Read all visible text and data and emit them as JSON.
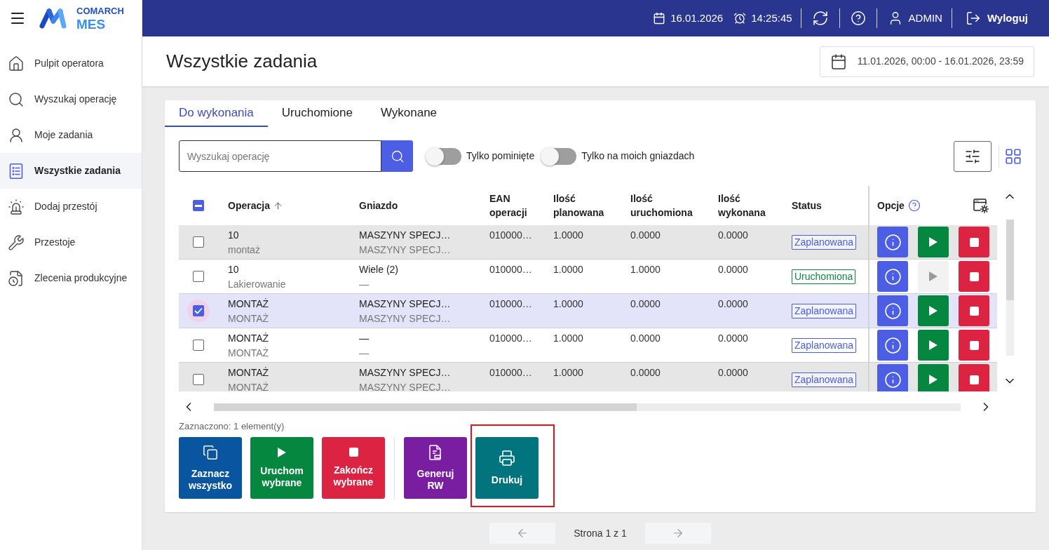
{
  "sidebar": {
    "logo": {
      "brand": "COMARCH",
      "product": "MES"
    },
    "items": [
      {
        "label": "Pulpit operatora",
        "kind": "home",
        "selected": false
      },
      {
        "label": "Wyszukaj operację",
        "kind": "search",
        "selected": false
      },
      {
        "label": "Moje zadania",
        "kind": "person",
        "selected": false
      },
      {
        "label": "Wszystkie zadania",
        "kind": "list",
        "selected": true
      },
      {
        "label": "Dodaj przestój",
        "kind": "siren",
        "selected": false
      },
      {
        "label": "Przestoje",
        "kind": "wrench",
        "selected": false
      },
      {
        "label": "Zlecenia produkcyjne",
        "kind": "orders",
        "selected": false
      }
    ]
  },
  "top_bar": {
    "date": "16.01.2026",
    "time": "14:25:45",
    "user": "ADMIN",
    "logout": "Wyloguj"
  },
  "header": {
    "title": "Wszystkie zadania",
    "date_range": "11.01.2026, 00:00 - 16.01.2026, 23:59"
  },
  "tabs": [
    {
      "label": "Do wykonania",
      "selected": true
    },
    {
      "label": "Uruchomione",
      "selected": false
    },
    {
      "label": "Wykonane",
      "selected": false
    }
  ],
  "search": {
    "placeholder": "Wyszukaj operację"
  },
  "toggles": [
    {
      "label": "Tylko pominięte",
      "on": false
    },
    {
      "label": "Tylko na moich gniazdach",
      "on": false
    }
  ],
  "table": {
    "select_all": {
      "indeterminate": true
    },
    "columns": [
      {
        "label": "Operacja",
        "sorted_ascending": true
      },
      {
        "label": "Gniazdo",
        "sorted_ascending": false
      },
      {
        "label": "EAN operacji",
        "sorted_ascending": false
      },
      {
        "label": "Ilość planowana",
        "sorted_ascending": false
      },
      {
        "label": "Ilość uruchomiona",
        "sorted_ascending": false
      },
      {
        "label": "Ilość wykonana",
        "sorted_ascending": false
      },
      {
        "label": "Status",
        "sorted_ascending": false
      }
    ],
    "options_label": "Opcje",
    "rows": [
      {
        "operation": "10",
        "operation_name": "montaż",
        "workstation": "MASZYNY SPECJ…",
        "workstation_sub": "MASZYNY SPECJ…",
        "ean": "010000…",
        "qty_planned": "1.0000",
        "qty_started": "0.0000",
        "qty_done": "0.0000",
        "status": {
          "label": "Zaplanowana",
          "color": "#4b5ee4"
        },
        "play_disabled": false,
        "selected": false
      },
      {
        "operation": "10",
        "operation_name": "Lakierowanie",
        "workstation": "Wiele (2)",
        "workstation_sub": "—",
        "ean": "010000…",
        "qty_planned": "1.0000",
        "qty_started": "1.0000",
        "qty_done": "0.0000",
        "status": {
          "label": "Uruchomiona",
          "color": "#0a8a3f"
        },
        "play_disabled": true,
        "selected": false
      },
      {
        "operation": "MONTAŻ",
        "operation_name": "MONTAŻ",
        "workstation": "MASZYNY SPECJ…",
        "workstation_sub": "MASZYNY SPECJ…",
        "ean": "010000…",
        "qty_planned": "1.0000",
        "qty_started": "0.0000",
        "qty_done": "0.0000",
        "status": {
          "label": "Zaplanowana",
          "color": "#4b5ee4"
        },
        "play_disabled": false,
        "selected": true
      },
      {
        "operation": "MONTAŻ",
        "operation_name": "MONTAŻ",
        "workstation": "—",
        "workstation_sub": "—",
        "ean": "010000…",
        "qty_planned": "1.0000",
        "qty_started": "0.0000",
        "qty_done": "0.0000",
        "status": {
          "label": "Zaplanowana",
          "color": "#4b5ee4"
        },
        "play_disabled": false,
        "selected": false
      },
      {
        "operation": "MONTAŻ",
        "operation_name": "MONTAŻ",
        "workstation": "MASZYNY SPECJ…",
        "workstation_sub": "MASZYNY SPECJ…",
        "ean": "010000…",
        "qty_planned": "1.0000",
        "qty_started": "0.0000",
        "qty_done": "0.0000",
        "status": {
          "label": "Zaplanowana",
          "color": "#4b5ee4"
        },
        "play_disabled": false,
        "selected": false
      }
    ]
  },
  "selection_summary": "Zaznaczono: 1 element(y)",
  "action_groups": [
    {
      "buttons": [
        {
          "label": "Zaznacz wszystko",
          "kind": "select_all",
          "highlighted": false
        },
        {
          "label": "Uruchom wybrane",
          "kind": "start",
          "highlighted": false
        },
        {
          "label": "Zakończ wybrane",
          "kind": "finish",
          "highlighted": false
        }
      ]
    },
    {
      "buttons": [
        {
          "label": "Generuj RW",
          "kind": "generate_rw",
          "highlighted": false
        },
        {
          "label": "Drukuj",
          "kind": "print",
          "highlighted": true
        }
      ]
    }
  ],
  "pagination": {
    "label": "Strona 1 z 1"
  }
}
